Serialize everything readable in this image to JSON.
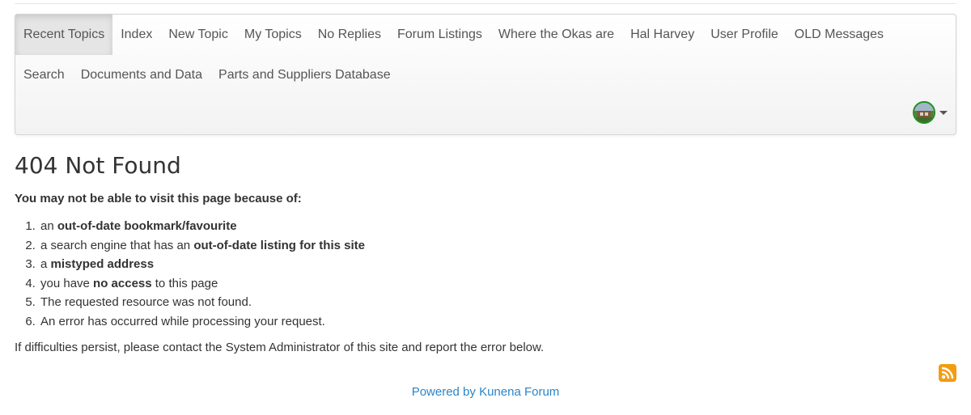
{
  "nav": {
    "row1": [
      "Recent Topics",
      "Index",
      "New Topic",
      "My Topics",
      "No Replies",
      "Forum Listings",
      "Where the Okas are",
      "Hal Harvey",
      "User Profile",
      "OLD Messages"
    ],
    "row2": [
      "Search",
      "Documents and Data",
      "Parts and Suppliers Database"
    ],
    "user_menu_icon": "user-avatar-icon"
  },
  "error": {
    "title": "404 Not Found",
    "lead": "You may not be able to visit this page because of:",
    "reasons": [
      {
        "pre": "an ",
        "bold": "out-of-date bookmark/favourite",
        "post": ""
      },
      {
        "pre": "a search engine that has an ",
        "bold": "out-of-date listing for this site",
        "post": ""
      },
      {
        "pre": "a ",
        "bold": "mistyped address",
        "post": ""
      },
      {
        "pre": "you have ",
        "bold": "no access",
        "post": " to this page"
      },
      {
        "pre": "The requested resource was not found.",
        "bold": "",
        "post": ""
      },
      {
        "pre": "An error has occurred while processing your request.",
        "bold": "",
        "post": ""
      }
    ],
    "persist": "If difficulties persist, please contact the System Administrator of this site and report the error below."
  },
  "footer": {
    "powered_by": "Powered by Kunena Forum",
    "rss_icon": "rss-icon"
  },
  "colors": {
    "link": "#2a85c8",
    "rss": "#f39c12",
    "avatar_ring": "#1f8f1f"
  }
}
